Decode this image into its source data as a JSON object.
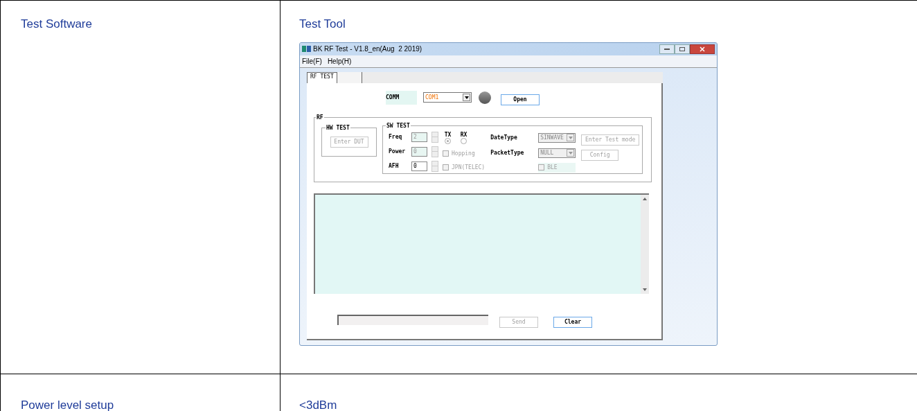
{
  "table": {
    "rows": [
      {
        "label": "Test Software",
        "value": "Test Tool",
        "screenshot": {
          "window": {
            "title": "BK RF Test - V1.8_en(Aug  2 2019)"
          },
          "menu": [
            "File(F)",
            "Help(H)"
          ],
          "tabs": [
            {
              "label": "RF TEST",
              "selected": true
            },
            {
              "selected": false
            }
          ],
          "comm": {
            "label": "COMM",
            "value": "COM1",
            "button": "Open"
          },
          "rf": {
            "title": "RF",
            "hw_test": {
              "title": "HW TEST",
              "button": {
                "label": "Enter DUT",
                "disabled": true
              }
            },
            "sw_test": {
              "title": "SW TEST",
              "fields": [
                {
                  "label": "Freq",
                  "value": "2",
                  "disabled": true
                },
                {
                  "label": "Power",
                  "value": "0",
                  "disabled": true
                },
                {
                  "label": "AFH",
                  "value": "0",
                  "disabled": false
                }
              ],
              "radios": [
                {
                  "label": "TX",
                  "selected": true,
                  "disabled": true
                },
                {
                  "label": "RX",
                  "selected": false,
                  "disabled": true
                }
              ],
              "checkboxes": [
                {
                  "label": "Hopping",
                  "checked": false,
                  "disabled": true
                },
                {
                  "label": "JPN(TELEC)",
                  "checked": false,
                  "disabled": true
                }
              ],
              "selects": [
                {
                  "label": "DateType",
                  "value": "SINWAVE",
                  "disabled": true
                },
                {
                  "label": "PacketType",
                  "value": "NULL",
                  "disabled": true
                }
              ],
              "buttons": [
                {
                  "label": "Enter Test mode",
                  "disabled": true
                },
                {
                  "label": "Config",
                  "disabled": true
                }
              ],
              "ble": {
                "label": "BLE",
                "checked": false,
                "disabled": true
              }
            }
          },
          "bottom": {
            "buttons": [
              {
                "label": "Send",
                "disabled": true
              },
              {
                "label": "Clear",
                "disabled": false
              }
            ]
          }
        }
      },
      {
        "label": "Power level setup",
        "value": "<3dBm"
      }
    ]
  }
}
